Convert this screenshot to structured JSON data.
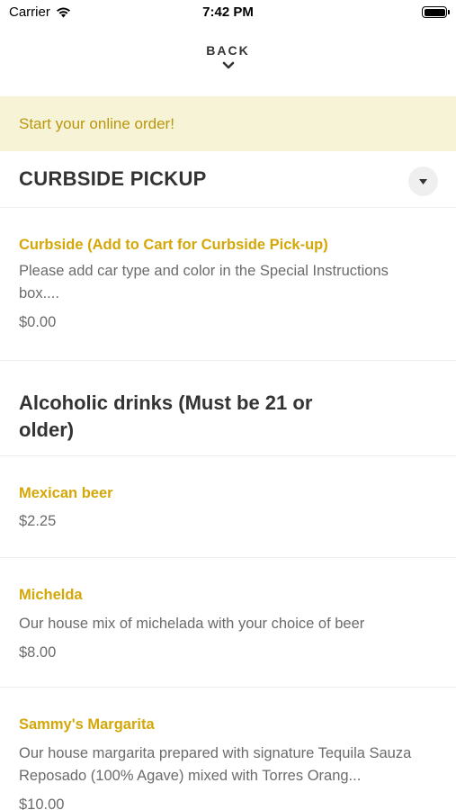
{
  "status_bar": {
    "carrier": "Carrier",
    "time": "7:42 PM"
  },
  "nav": {
    "back_label": "BACK"
  },
  "banner": {
    "text": "Start your online order!"
  },
  "section": {
    "title": "CURBSIDE PICKUP"
  },
  "items": [
    {
      "name": "Curbside (Add to Cart for Curbside Pick-up)",
      "description": "Please add car type and color in the Special Instructions box....",
      "price": "$0.00"
    }
  ],
  "category": {
    "title": "Alcoholic drinks (Must be 21 or older)",
    "items": [
      {
        "name": "Mexican beer",
        "description": "",
        "price": "$2.25"
      },
      {
        "name": "Michelda",
        "description": "Our house mix of michelada with your choice of beer",
        "price": "$8.00"
      },
      {
        "name": "Sammy's Margarita",
        "description": "Our house margarita prepared with signature Tequila Sauza Reposado (100% Agave) mixed with Torres Orang...",
        "price": "$10.00"
      }
    ]
  },
  "colors": {
    "accent": "#d4a708",
    "banner_bg": "#f7f3d6",
    "banner_text": "#b9960e"
  }
}
